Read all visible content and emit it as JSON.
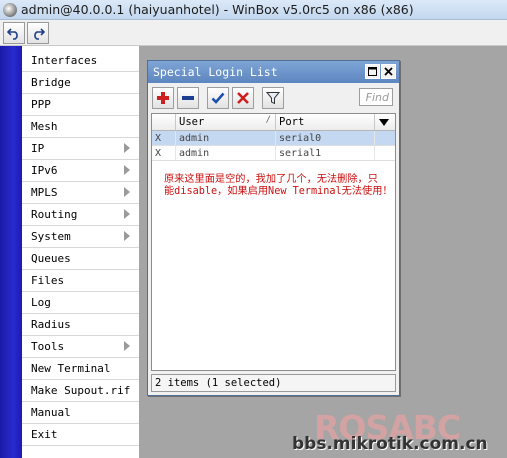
{
  "window": {
    "title": "admin@40.0.0.1 (haiyuanhotel) - WinBox v5.0rc5 on x86 (x86)",
    "icon": "winbox-app-icon"
  },
  "toolbar": {
    "undo_icon": "undo-icon",
    "redo_icon": "redo-icon"
  },
  "menu": {
    "items": [
      {
        "label": "Interfaces",
        "submenu": false
      },
      {
        "label": "Bridge",
        "submenu": false
      },
      {
        "label": "PPP",
        "submenu": false
      },
      {
        "label": "Mesh",
        "submenu": false
      },
      {
        "label": "IP",
        "submenu": true
      },
      {
        "label": "IPv6",
        "submenu": true
      },
      {
        "label": "MPLS",
        "submenu": true
      },
      {
        "label": "Routing",
        "submenu": true
      },
      {
        "label": "System",
        "submenu": true
      },
      {
        "label": "Queues",
        "submenu": false
      },
      {
        "label": "Files",
        "submenu": false
      },
      {
        "label": "Log",
        "submenu": false
      },
      {
        "label": "Radius",
        "submenu": false
      },
      {
        "label": "Tools",
        "submenu": true
      },
      {
        "label": "New Terminal",
        "submenu": false
      },
      {
        "label": "Make Supout.rif",
        "submenu": false
      },
      {
        "label": "Manual",
        "submenu": false
      },
      {
        "label": "Exit",
        "submenu": false
      }
    ]
  },
  "dialog": {
    "title": "Special Login List",
    "toolbar": {
      "buttons": [
        "add-icon",
        "remove-icon",
        "enable-icon",
        "disable-icon",
        "filter-icon"
      ],
      "find_placeholder": "Find"
    },
    "table": {
      "columns": [
        "User",
        "Port"
      ],
      "sort_indicator": "/",
      "rows": [
        {
          "flag": "X",
          "user": "admin",
          "port": "serial0",
          "selected": true
        },
        {
          "flag": "X",
          "user": "admin",
          "port": "serial1",
          "selected": false
        }
      ]
    },
    "note_line1": "原来这里面是空的，我加了几个，无法删除，只",
    "note_line2": "能disable，如果启用New Terminal无法使用！",
    "status": "2 items (1 selected)"
  },
  "watermark": {
    "logo": "ROSABC",
    "url": "bbs.mikrotik.com.cn"
  },
  "colors": {
    "brand_strip": "#1f1fbf",
    "workspace": "#a5a5a5",
    "dialog_title": "#6b93c9",
    "note_text": "#cc1010",
    "selected_row": "#c4d8f1",
    "add_button": "#cc2020",
    "enable_button": "#1a4fb0"
  }
}
